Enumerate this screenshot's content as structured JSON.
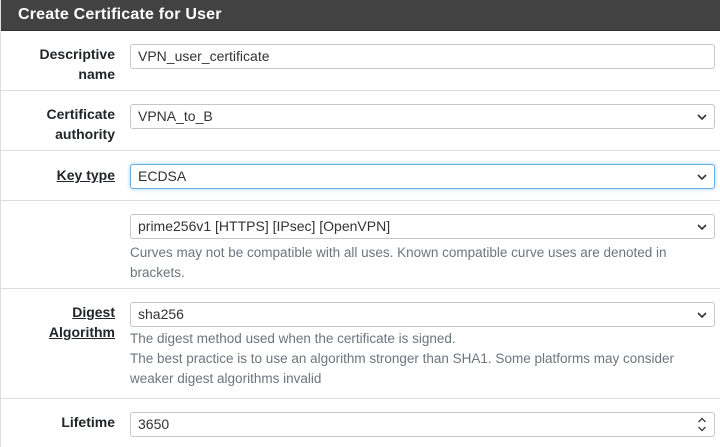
{
  "panel": {
    "title": "Create Certificate for User"
  },
  "rows": {
    "descriptive_name": {
      "label_line1": "Descriptive",
      "label_line2": "name",
      "value": "VPN_user_certificate"
    },
    "certificate_authority": {
      "label_line1": "Certificate",
      "label_line2": "authority",
      "selected": "VPNA_to_B"
    },
    "key_type": {
      "label": "Key type",
      "selected": "ECDSA"
    },
    "curve": {
      "selected": "prime256v1 [HTTPS] [IPsec] [OpenVPN]",
      "help": "Curves may not be compatible with all uses. Known compatible curve uses are denoted in brackets."
    },
    "digest": {
      "label_line1": "Digest",
      "label_line2": "Algorithm",
      "selected": "sha256",
      "help_line1": "The digest method used when the certificate is signed.",
      "help_line2": "The best practice is to use an algorithm stronger than SHA1. Some platforms may consider weaker digest algorithms invalid"
    },
    "lifetime": {
      "label": "Lifetime",
      "value": "3650"
    }
  },
  "icons": {
    "select": "chevron-down-icon",
    "number": "spinner-icon"
  }
}
